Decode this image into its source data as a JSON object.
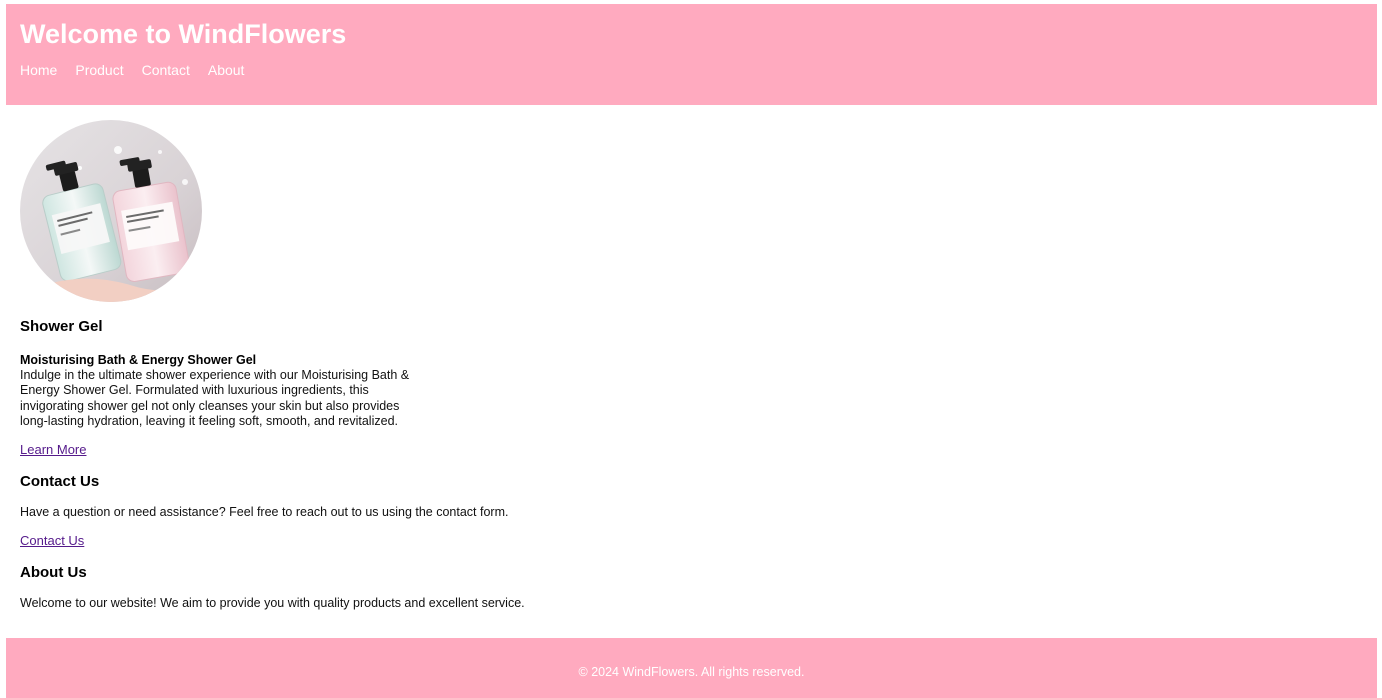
{
  "header": {
    "title": "Welcome to WindFlowers",
    "nav": [
      "Home",
      "Product",
      "Contact",
      "About"
    ]
  },
  "product": {
    "section_title": "Shower Gel",
    "name": "Moisturising Bath & Energy Shower Gel",
    "description": "Indulge in the ultimate shower experience with our Moisturising Bath & Energy Shower Gel. Formulated with luxurious ingredients, this invigorating shower gel not only cleanses your skin but also provides long-lasting hydration, leaving it feeling soft, smooth, and revitalized.",
    "link_label": "Learn More",
    "image_icon": "shower-gel-bottles-photo"
  },
  "contact": {
    "title": "Contact Us",
    "text": "Have a question or need assistance? Feel free to reach out to us using the contact form.",
    "link_label": "Contact Us"
  },
  "about": {
    "title": "About Us",
    "text": "Welcome to our website! We aim to provide you with quality products and excellent service."
  },
  "footer": {
    "copyright": "© 2024 WindFlowers. All rights reserved."
  },
  "colors": {
    "brand_pink": "#ffaabf",
    "link_visited": "#551a8b"
  }
}
